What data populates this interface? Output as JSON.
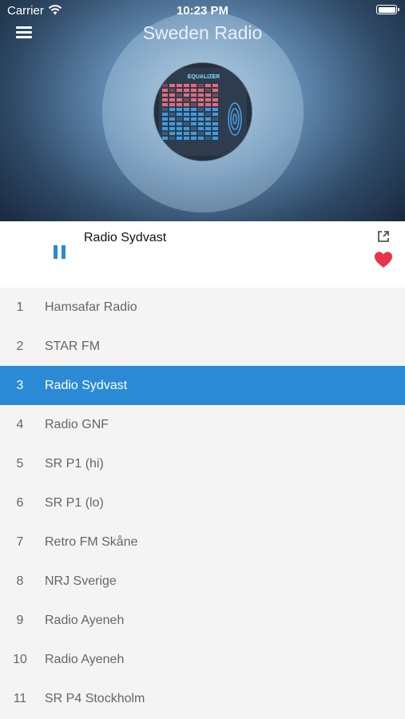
{
  "status_bar": {
    "carrier": "Carrier",
    "time": "10:23 PM"
  },
  "header": {
    "title": "Sweden Radio",
    "menu_icon": "hamburger-icon"
  },
  "artwork": {
    "label": "EQUALIZER"
  },
  "now_playing": {
    "title": "Radio Sydvast",
    "state": "playing",
    "favorite": true
  },
  "colors": {
    "accent": "#2a8ad6",
    "heart": "#e8344a"
  },
  "stations": [
    {
      "number": "1",
      "name": "Hamsafar Radio"
    },
    {
      "number": "2",
      "name": "STAR FM"
    },
    {
      "number": "3",
      "name": "Radio Sydvast",
      "selected": true
    },
    {
      "number": "4",
      "name": "Radio GNF"
    },
    {
      "number": "5",
      "name": "SR P1 (hi)"
    },
    {
      "number": "6",
      "name": "SR P1 (lo)"
    },
    {
      "number": "7",
      "name": "Retro FM Skåne"
    },
    {
      "number": "8",
      "name": "NRJ Sverige"
    },
    {
      "number": "9",
      "name": "Radio Ayeneh"
    },
    {
      "number": "10",
      "name": "Radio Ayeneh"
    },
    {
      "number": "11",
      "name": "SR P4 Stockholm"
    }
  ]
}
